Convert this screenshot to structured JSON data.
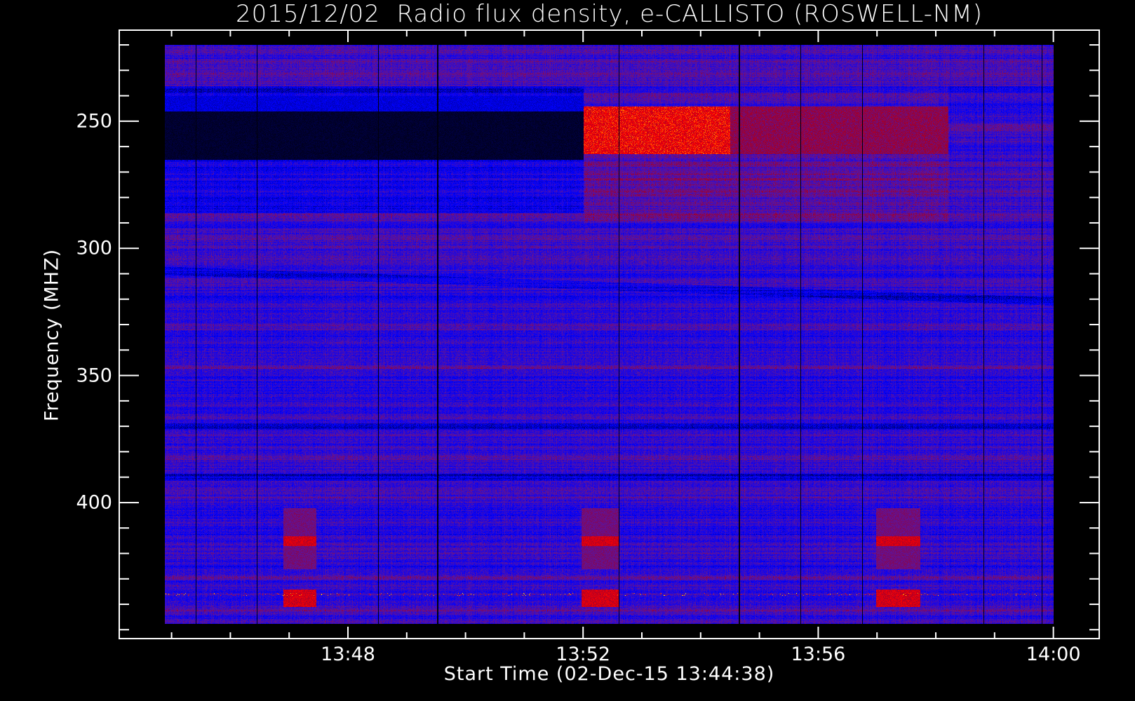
{
  "chart_data": {
    "type": "heatmap",
    "title": "2015/12/02  Radio flux density, e-CALLISTO (ROSWELL-NM)",
    "xlabel": "Start Time (02-Dec-15 13:44:38)",
    "ylabel": "Frequency (MHZ)",
    "x_units": "minutes after 13:44 UT",
    "xlim": [
      0.11,
      16.78
    ],
    "data_time_range": [
      0.885,
      16.0
    ],
    "ylim": [
      453.5,
      214.2
    ],
    "data_freq_range": [
      220,
      447.7
    ],
    "y_inverted": true,
    "x_ticks": [
      {
        "value": 4,
        "label": "13:48"
      },
      {
        "value": 8,
        "label": "13:52"
      },
      {
        "value": 12,
        "label": "13:56"
      },
      {
        "value": 16,
        "label": "14:00"
      }
    ],
    "x_minor_step": 1,
    "y_ticks": [
      {
        "value": 250,
        "label": "250"
      },
      {
        "value": 300,
        "label": "300"
      },
      {
        "value": 350,
        "label": "350"
      },
      {
        "value": 400,
        "label": "400"
      }
    ],
    "y_minor_step": 10,
    "colormap": [
      [
        0,
        "#000000"
      ],
      [
        0.35,
        "#0000ff"
      ],
      [
        0.55,
        "#5a14a0"
      ],
      [
        0.7,
        "#9a0030"
      ],
      [
        0.85,
        "#ff0000"
      ],
      [
        0.95,
        "#ffff00"
      ]
    ],
    "features": {
      "low_signal_band": {
        "t": [
          0.885,
          8.0
        ],
        "f": [
          237,
          286
        ],
        "core": [
          246,
          265
        ]
      },
      "enhanced_band": [
        {
          "t": [
            8.0,
            10.5
          ],
          "f": [
            244,
            263
          ],
          "level": 0.82
        },
        {
          "t": [
            10.5,
            14.2
          ],
          "f": [
            244,
            263
          ],
          "level": 0.66
        }
      ],
      "periodic_blocks": {
        "t": [
          [
            2.9,
            3.45
          ],
          [
            7.97,
            8.6
          ],
          [
            12.97,
            13.73
          ]
        ],
        "f": [
          [
            402,
            426
          ],
          [
            434,
            441
          ]
        ]
      },
      "dropout_columns": [
        1.41,
        2.45,
        4.51,
        5.52,
        8.6,
        10.65,
        11.69,
        12.74,
        14.81,
        15.8
      ],
      "dark_rows": [
        237.5,
        370,
        390
      ],
      "noisy_row": 436
    }
  }
}
